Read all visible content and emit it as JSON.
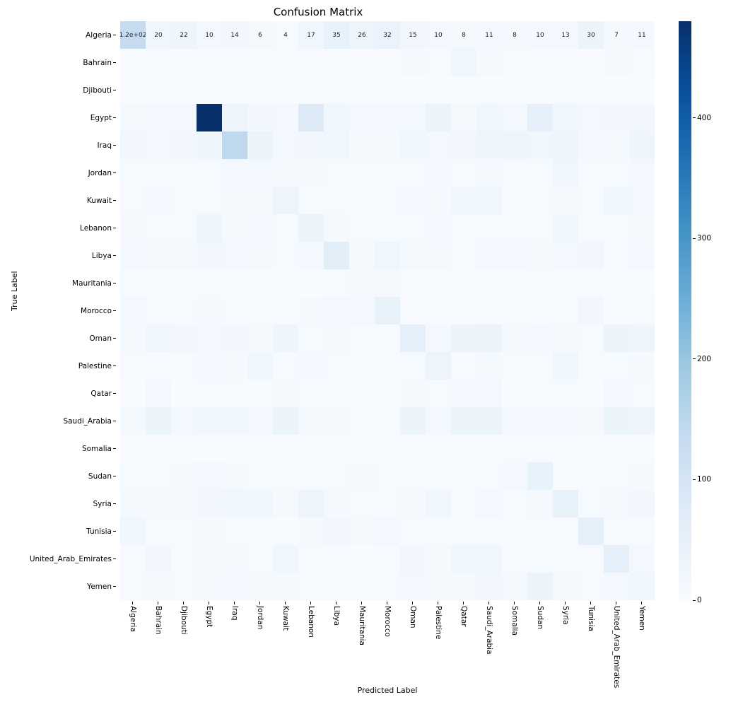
{
  "title": "Confusion Matrix",
  "xlabel": "Predicted Label",
  "ylabel": "True Label",
  "labels": [
    "Algeria",
    "Bahrain",
    "Djibouti",
    "Egypt",
    "Iraq",
    "Jordan",
    "Kuwait",
    "Lebanon",
    "Libya",
    "Mauritania",
    "Morocco",
    "Oman",
    "Palestine",
    "Qatar",
    "Saudi_Arabia",
    "Somalia",
    "Sudan",
    "Syria",
    "Tunisia",
    "United_Arab_Emirates",
    "Yemen"
  ],
  "row0_text": [
    "1.2e+02",
    "20",
    "22",
    "10",
    "14",
    "6",
    "4",
    "17",
    "35",
    "26",
    "32",
    "15",
    "10",
    "8",
    "11",
    "8",
    "10",
    "13",
    "30",
    "7",
    "11"
  ],
  "colorbar_ticks": [
    "0",
    "100",
    "200",
    "300",
    "400"
  ],
  "chart_data": {
    "type": "heatmap",
    "title": "Confusion Matrix",
    "xlabel": "Predicted Label",
    "ylabel": "True Label",
    "colormap": "Blues",
    "vmin": 0,
    "vmax": 480,
    "xlabels": [
      "Algeria",
      "Bahrain",
      "Djibouti",
      "Egypt",
      "Iraq",
      "Jordan",
      "Kuwait",
      "Lebanon",
      "Libya",
      "Mauritania",
      "Morocco",
      "Oman",
      "Palestine",
      "Qatar",
      "Saudi_Arabia",
      "Somalia",
      "Sudan",
      "Syria",
      "Tunisia",
      "United_Arab_Emirates",
      "Yemen"
    ],
    "ylabels": [
      "Algeria",
      "Bahrain",
      "Djibouti",
      "Egypt",
      "Iraq",
      "Jordan",
      "Kuwait",
      "Lebanon",
      "Libya",
      "Mauritania",
      "Morocco",
      "Oman",
      "Palestine",
      "Qatar",
      "Saudi_Arabia",
      "Somalia",
      "Sudan",
      "Syria",
      "Tunisia",
      "United_Arab_Emirates",
      "Yemen"
    ],
    "colorbar_ticks": [
      0,
      100,
      200,
      300,
      400
    ],
    "matrix": [
      [
        120,
        20,
        22,
        10,
        14,
        6,
        4,
        17,
        35,
        26,
        32,
        15,
        10,
        8,
        11,
        8,
        10,
        13,
        30,
        7,
        11
      ],
      [
        0,
        2,
        0,
        3,
        3,
        1,
        2,
        1,
        0,
        0,
        0,
        7,
        3,
        20,
        8,
        2,
        3,
        2,
        0,
        8,
        3
      ],
      [
        0,
        0,
        0,
        0,
        0,
        0,
        0,
        0,
        0,
        0,
        0,
        0,
        0,
        0,
        0,
        0,
        0,
        0,
        0,
        0,
        0
      ],
      [
        8,
        12,
        10,
        480,
        25,
        15,
        12,
        60,
        20,
        10,
        12,
        12,
        30,
        8,
        18,
        12,
        40,
        20,
        10,
        15,
        15
      ],
      [
        15,
        10,
        15,
        22,
        130,
        30,
        12,
        15,
        20,
        8,
        8,
        20,
        12,
        15,
        22,
        22,
        20,
        22,
        10,
        8,
        22
      ],
      [
        4,
        3,
        3,
        5,
        10,
        12,
        6,
        8,
        4,
        2,
        3,
        4,
        10,
        3,
        8,
        2,
        4,
        18,
        2,
        4,
        10
      ],
      [
        2,
        12,
        4,
        5,
        8,
        6,
        25,
        4,
        2,
        0,
        2,
        12,
        6,
        18,
        18,
        2,
        2,
        6,
        2,
        20,
        10
      ],
      [
        6,
        4,
        4,
        22,
        8,
        10,
        4,
        30,
        8,
        3,
        5,
        4,
        10,
        2,
        5,
        4,
        4,
        20,
        5,
        4,
        6
      ],
      [
        12,
        6,
        8,
        15,
        12,
        6,
        4,
        10,
        50,
        8,
        18,
        8,
        6,
        3,
        12,
        12,
        8,
        10,
        15,
        4,
        10
      ],
      [
        4,
        0,
        0,
        2,
        1,
        0,
        0,
        1,
        2,
        8,
        6,
        1,
        0,
        0,
        0,
        4,
        2,
        0,
        2,
        0,
        0
      ],
      [
        12,
        2,
        4,
        6,
        3,
        2,
        0,
        6,
        12,
        10,
        35,
        2,
        4,
        0,
        2,
        2,
        4,
        3,
        15,
        0,
        3
      ],
      [
        8,
        18,
        15,
        12,
        15,
        8,
        22,
        4,
        8,
        3,
        4,
        40,
        10,
        30,
        30,
        8,
        10,
        8,
        5,
        28,
        22
      ],
      [
        3,
        3,
        2,
        10,
        8,
        18,
        4,
        10,
        3,
        2,
        2,
        4,
        25,
        2,
        8,
        2,
        3,
        20,
        2,
        4,
        8
      ],
      [
        0,
        10,
        0,
        2,
        2,
        1,
        6,
        1,
        0,
        0,
        0,
        6,
        2,
        12,
        10,
        0,
        2,
        2,
        0,
        10,
        4
      ],
      [
        8,
        30,
        10,
        18,
        20,
        10,
        30,
        8,
        8,
        3,
        5,
        30,
        12,
        30,
        30,
        10,
        12,
        12,
        6,
        30,
        22
      ],
      [
        0,
        0,
        1,
        0,
        0,
        0,
        0,
        0,
        0,
        0,
        0,
        0,
        0,
        0,
        0,
        2,
        2,
        0,
        0,
        0,
        0
      ],
      [
        4,
        3,
        6,
        10,
        6,
        3,
        2,
        4,
        4,
        6,
        4,
        3,
        3,
        0,
        4,
        12,
        35,
        4,
        3,
        2,
        6
      ],
      [
        8,
        6,
        6,
        15,
        20,
        18,
        6,
        25,
        8,
        4,
        5,
        6,
        18,
        4,
        10,
        4,
        6,
        35,
        4,
        6,
        14
      ],
      [
        20,
        2,
        3,
        6,
        3,
        2,
        1,
        6,
        14,
        6,
        12,
        2,
        3,
        0,
        2,
        2,
        3,
        3,
        40,
        2,
        3
      ],
      [
        3,
        15,
        4,
        6,
        6,
        4,
        20,
        3,
        2,
        0,
        2,
        14,
        6,
        20,
        18,
        2,
        4,
        4,
        2,
        45,
        12
      ],
      [
        3,
        6,
        4,
        8,
        10,
        6,
        8,
        4,
        3,
        2,
        2,
        10,
        6,
        6,
        14,
        8,
        30,
        8,
        2,
        10,
        20
      ]
    ]
  }
}
